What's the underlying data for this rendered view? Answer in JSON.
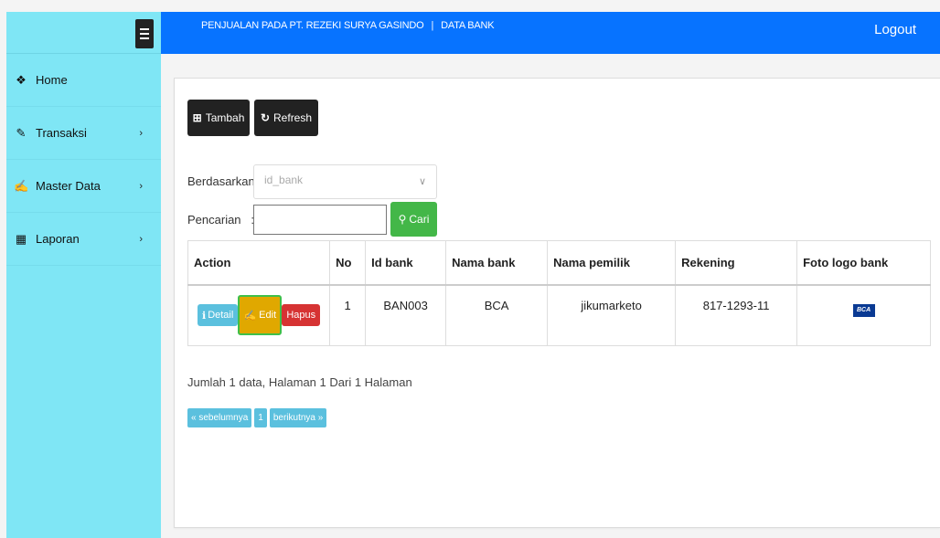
{
  "colors": {
    "sidebar": "#7fe6f5",
    "topbar": "#0773ff",
    "dark_button": "#222222",
    "search_button": "#43b748",
    "detail_button": "#5bc0de",
    "edit_button": "#e0a800",
    "delete_button": "#d63333"
  },
  "sidebar": {
    "menu_icon": "hamburger-icon",
    "items": [
      {
        "label": "Home",
        "icon": "home-icon",
        "has_submenu": false
      },
      {
        "label": "Transaksi",
        "icon": "pencil-icon",
        "has_submenu": true
      },
      {
        "label": "Master Data",
        "icon": "edit-icon",
        "has_submenu": true
      },
      {
        "label": "Laporan",
        "icon": "calendar-icon",
        "has_submenu": true
      }
    ]
  },
  "header": {
    "app_title": "PENJUALAN PADA PT. REZEKI SURYA GASINDO",
    "separator": "|",
    "page_title": "DATA BANK",
    "logout_label": "Logout"
  },
  "toolbar": {
    "add_label": "Tambah",
    "refresh_label": "Refresh"
  },
  "filter": {
    "by_label": "Berdasarkan:",
    "by_value": "id_bank",
    "search_label": "Pencarian   :",
    "search_value": "",
    "search_button_label": "Cari"
  },
  "table": {
    "columns": [
      "Action",
      "No",
      "Id bank",
      "Nama bank",
      "Nama pemilik",
      "Rekening",
      "Foto logo bank"
    ],
    "rows": [
      {
        "no": "1",
        "id_bank": "BAN003",
        "nama_bank": "BCA",
        "nama_pemilik": "jikumarketo",
        "rekening": "817-1293-11",
        "logo_text": "BCA"
      }
    ],
    "actions": {
      "detail": "Detail",
      "edit": "Edit",
      "hapus": "Hapus"
    }
  },
  "summary": "Jumlah 1 data, Halaman 1 Dari 1 Halaman",
  "pagination": {
    "prev": "« sebelumnya",
    "page": "1",
    "next": "berikutnya »"
  }
}
